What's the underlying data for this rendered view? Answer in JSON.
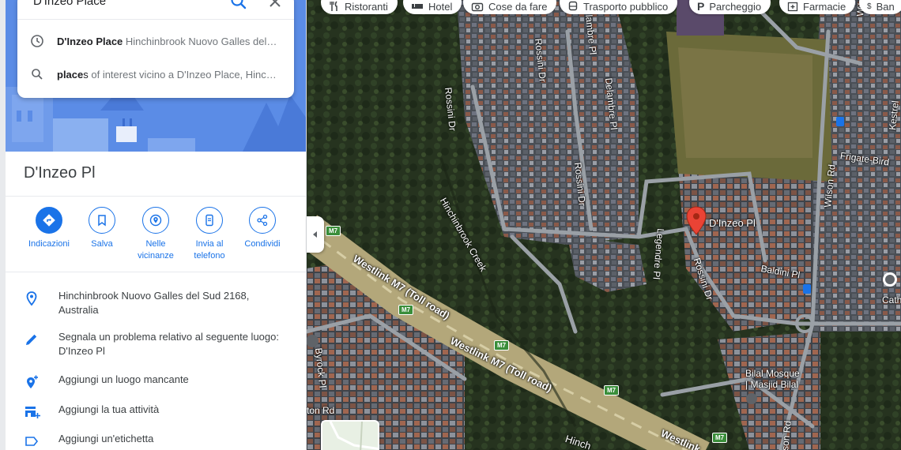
{
  "search": {
    "value": "D'Inzeo Place",
    "suggestions": [
      {
        "icon": "history-icon",
        "bold": "D'Inzeo Place",
        "rest": " Hinchinbrook Nuovo Galles del S..."
      },
      {
        "icon": "search-icon",
        "bold": "place",
        "mid": "s",
        "rest": " of interest vicino a D'Inzeo Place, Hinch..."
      }
    ]
  },
  "place": {
    "title": "D'Inzeo Pl"
  },
  "actions": [
    {
      "label": "Indicazioni"
    },
    {
      "label": "Salva"
    },
    {
      "label": "Nelle vicinanze"
    },
    {
      "label": "Invia al telefono"
    },
    {
      "label": "Condividi"
    }
  ],
  "info": [
    {
      "icon": "location-pin-icon",
      "text": "Hinchinbrook Nuovo Galles del Sud 2168, Australia"
    },
    {
      "icon": "pencil-icon",
      "text": "Segnala un problema relativo al seguente luogo: D'Inzeo Pl"
    },
    {
      "icon": "add-place-icon",
      "text": "Aggiungi un luogo mancante"
    },
    {
      "icon": "add-business-icon",
      "text": "Aggiungi la tua attività"
    },
    {
      "icon": "label-icon",
      "text": "Aggiungi un'etichetta"
    }
  ],
  "chips": [
    {
      "icon": "restaurant-icon",
      "label": "Ristoranti"
    },
    {
      "icon": "hotel-icon",
      "label": "Hotel"
    },
    {
      "icon": "camera-icon",
      "label": "Cose da fare"
    },
    {
      "icon": "transit-icon",
      "label": "Trasporto pubblico"
    },
    {
      "icon": "parking-icon",
      "label": "Parcheggio"
    },
    {
      "icon": "pharmacy-icon",
      "label": "Farmacie"
    },
    {
      "icon": "atm-icon",
      "label": "Ban"
    }
  ],
  "map_labels": {
    "pin": "D'Inzeo Pl",
    "rossini_dr_1": "Rossini Dr",
    "rossini_dr_2": "Rossini Dr",
    "rossini_dr_3": "Rossini Dr",
    "rossini_dr_4": "Rossini Dr",
    "delambre_pl_1": "Delambre Pl",
    "delambre_pl_2": "lambre Pl",
    "legendre_pl": "Legendre Pl",
    "wilson_rd_1": "Wilson Rd",
    "wilson_rd_2": "Wilson Rd",
    "wilson_rd_3": "son Rd",
    "frigate_bird": "Frigate-Bird",
    "kestrel": "Kestrel",
    "baldini_pl": "Baldini Pl",
    "hinchinbrook_creek": "Hinchinbrook Creek",
    "hinch": "Hinch",
    "westlink_1": "Westlink M7 (Toll road)",
    "westlink_2": "Westlink M7 (Toll road)",
    "westlink_3": "Westlink",
    "byrock_pl": "Byrock Pl",
    "ton_rd": "ton Rd",
    "mosque_1": "Bilal Mosque",
    "mosque_2": "| Masjid Bilal",
    "cath": "Cath",
    "m7": "M7"
  },
  "colors": {
    "accent": "#1a73e8",
    "hero": "#5b8ce6",
    "pin": "#ea4335"
  }
}
